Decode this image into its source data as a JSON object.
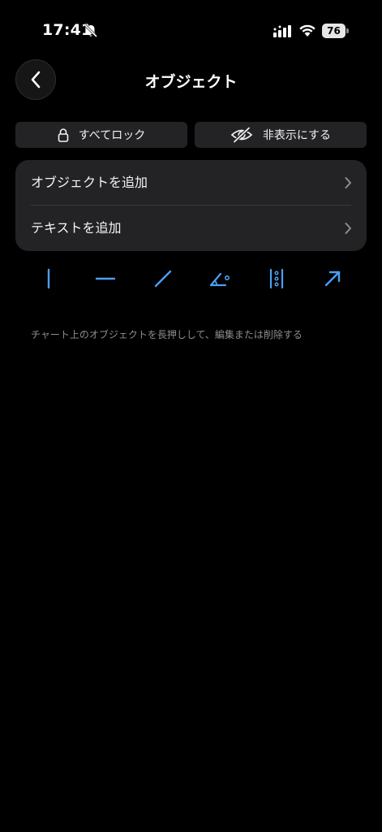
{
  "status_bar": {
    "time": "17:41",
    "battery_level": "76",
    "icons": [
      "bell-slash-icon",
      "signal-icon",
      "wifi-icon",
      "battery-icon"
    ]
  },
  "header": {
    "title": "オブジェクト",
    "back_icon": "chevron-left-icon"
  },
  "toolbar": {
    "lock_all_label": "すべてロック",
    "lock_icon": "lock-icon",
    "hide_label": "非表示にする",
    "hide_icon": "eye-slash-icon"
  },
  "menu": {
    "items": [
      {
        "label": "オブジェクトを追加",
        "icon": "chevron-right-icon"
      },
      {
        "label": "テキストを追加",
        "icon": "chevron-right-icon"
      }
    ]
  },
  "drawing_tools": {
    "accent_color": "#4a9ff5",
    "items": [
      "vertical-line-icon",
      "horizontal-line-icon",
      "trend-line-icon",
      "angle-line-icon",
      "fibonacci-levels-icon",
      "arrow-icon"
    ]
  },
  "hint": {
    "text": "チャート上のオブジェクトを長押しして、編集または削除する"
  }
}
